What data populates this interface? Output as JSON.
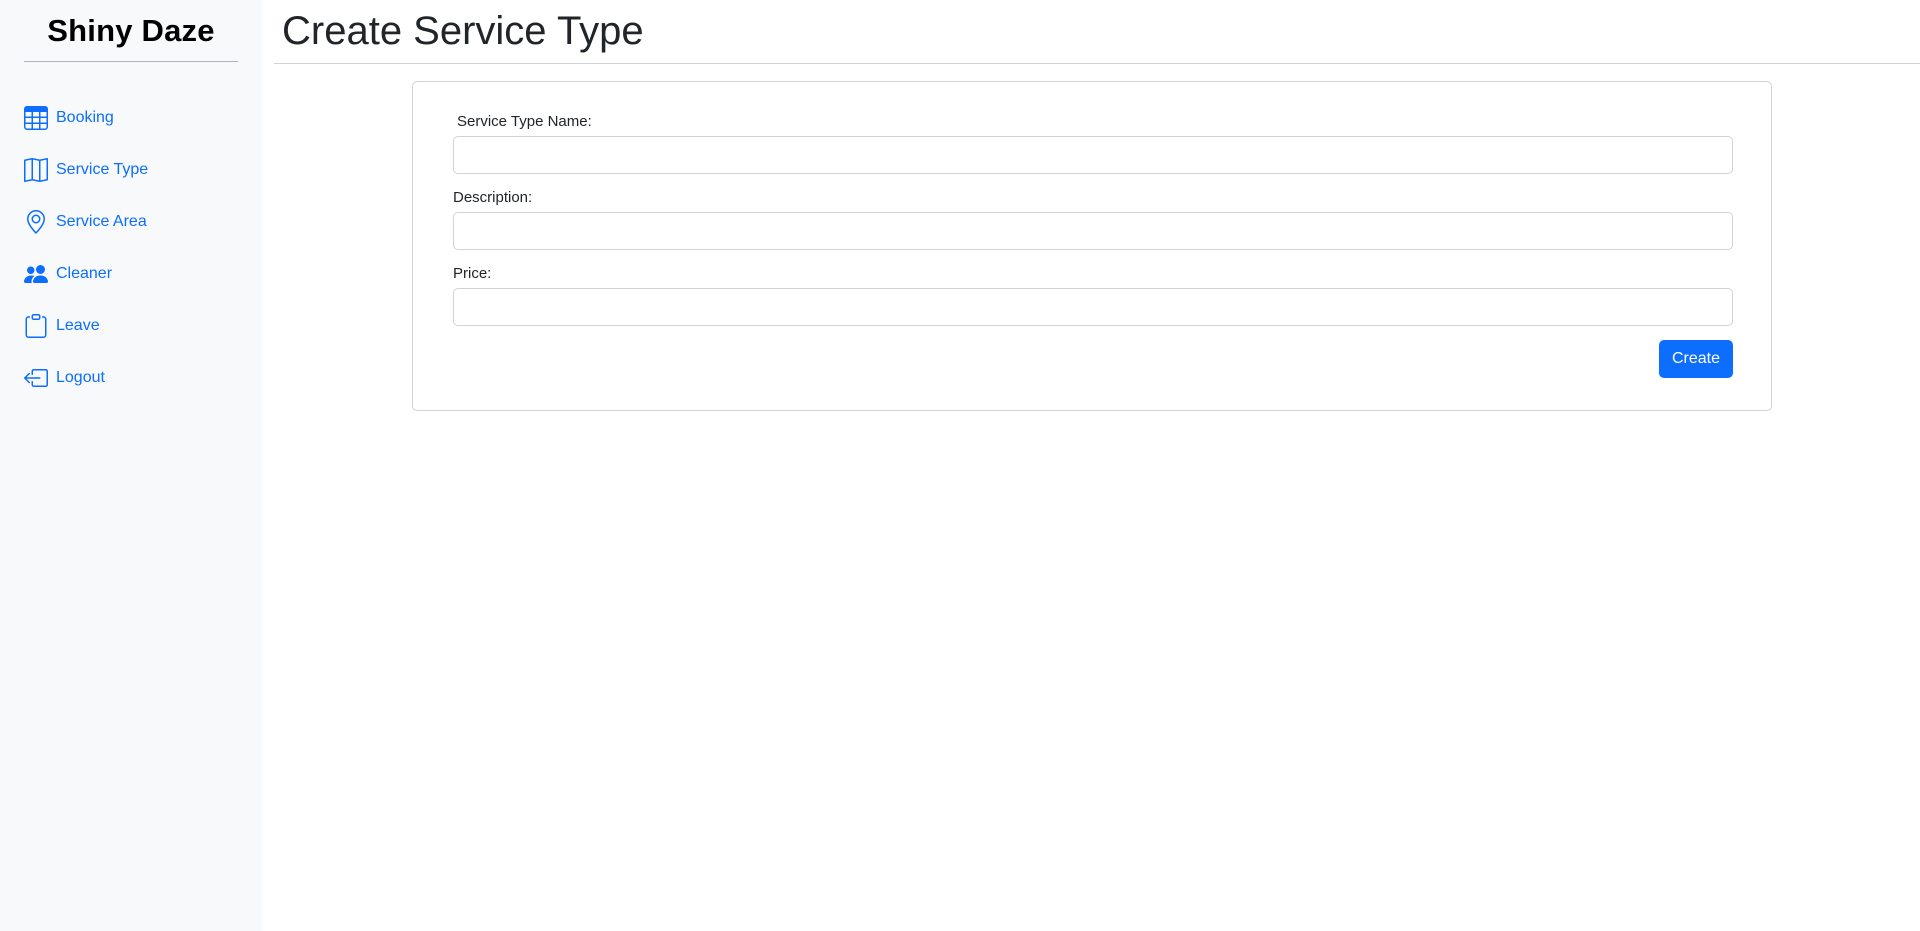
{
  "brand": {
    "name": "Shiny Daze"
  },
  "sidebar": {
    "items": [
      {
        "label": "Booking",
        "icon": "table-icon"
      },
      {
        "label": "Service Type",
        "icon": "map-icon"
      },
      {
        "label": "Service Area",
        "icon": "location-pin-icon"
      },
      {
        "label": "Cleaner",
        "icon": "people-icon"
      },
      {
        "label": "Leave",
        "icon": "clipboard-icon"
      },
      {
        "label": "Logout",
        "icon": "logout-icon"
      }
    ]
  },
  "page": {
    "title": "Create Service Type"
  },
  "form": {
    "service_type_name": {
      "label": "Service Type Name:",
      "value": ""
    },
    "description": {
      "label": "Description:",
      "value": ""
    },
    "price": {
      "label": "Price:",
      "value": ""
    },
    "submit_label": "Create"
  },
  "colors": {
    "accent": "#0d6efd",
    "sidebar_bg": "#f8f9fa",
    "border": "#ced4da"
  }
}
